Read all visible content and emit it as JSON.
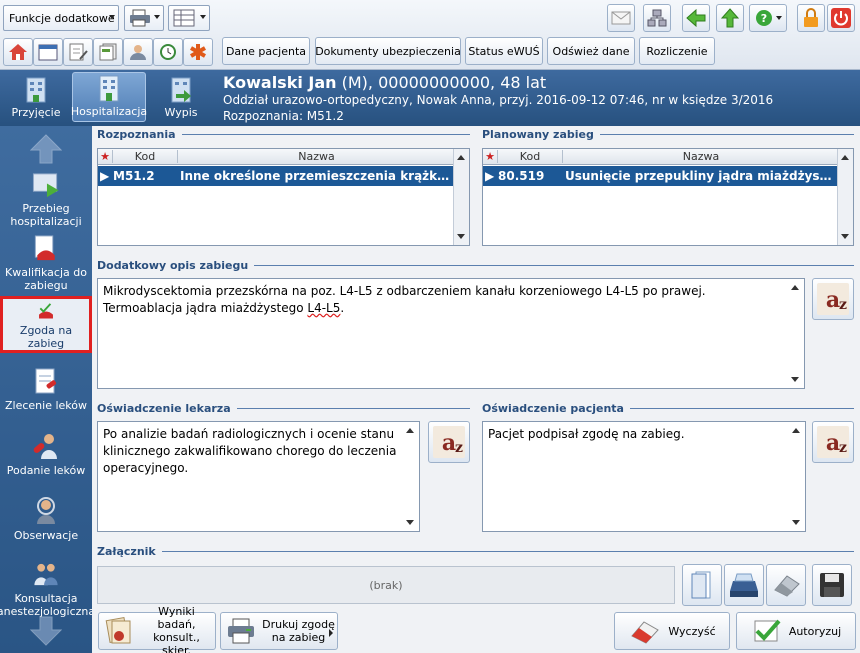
{
  "toolbar": {
    "functions_label": "Funkcje dodatkowe",
    "tabs": [
      "Dane pacjenta",
      "Dokumenty ubezpieczenia",
      "Status eWUŚ",
      "Odśwież dane",
      "Rozliczenie"
    ]
  },
  "header": {
    "name": "Kowalski Jan",
    "details": " (M), 00000000000, 48 lat",
    "line2": "Oddział urazowo-ortopedyczny, Nowak Anna, przyj. 2016-09-12 07:46, nr w księdze 3/2016",
    "line3": "Rozpoznania: M51.2",
    "modes": [
      "Przyjęcie",
      "Hospitalizacja",
      "Wypis"
    ]
  },
  "sidebar": {
    "items": [
      {
        "label": "Przebieg hospitalizacji"
      },
      {
        "label": "Kwalifikacja do zabiegu"
      },
      {
        "label": "Zgoda na zabieg"
      },
      {
        "label": "Zlecenie leków"
      },
      {
        "label": "Podanie leków"
      },
      {
        "label": "Obserwacje"
      },
      {
        "label": "Konsultacja anestezjologiczna"
      }
    ]
  },
  "diagnoses": {
    "title": "Rozpoznania",
    "col_code": "Kod",
    "col_name": "Nazwa",
    "row": {
      "code": "M51.2",
      "name": "Inne określone przemieszczenia krążka międzykręgowego"
    }
  },
  "planned": {
    "title": "Planowany zabieg",
    "col_code": "Kod",
    "col_name": "Nazwa",
    "row": {
      "code": "80.519",
      "name": "Usunięcie przepukliny jądra miażdżystego"
    }
  },
  "extra": {
    "title": "Dodatkowy opis zabiegu",
    "text1": "Mikrodyscektomia przezskórna na poz. L4-L5 z odbarczeniem kanału korzeniowego L4-L5 po prawej. Termoablacja jądra miażdżystego ",
    "text_err": "L4-L5",
    "text_end": "."
  },
  "doctor": {
    "title": "Oświadczenie lekarza",
    "text": "Po analizie badań radiologicznych i ocenie stanu klinicznego zakwalifikowano chorego do leczenia operacyjnego."
  },
  "patient": {
    "title": "Oświadczenie pacjenta",
    "text": "Pacjet podpisał zgodę na zabieg."
  },
  "attachment": {
    "title": "Załącznik",
    "empty": "(brak)"
  },
  "bottom": {
    "results": "Wyniki badań, konsult., skier.",
    "print": "Drukuj zgodę na zabieg",
    "clear": "Wyczyść",
    "authorize": "Autoryzuj"
  },
  "colors": {
    "accent": "#1c5896",
    "header": "#2f5b8f",
    "highlight": "#e02020"
  }
}
